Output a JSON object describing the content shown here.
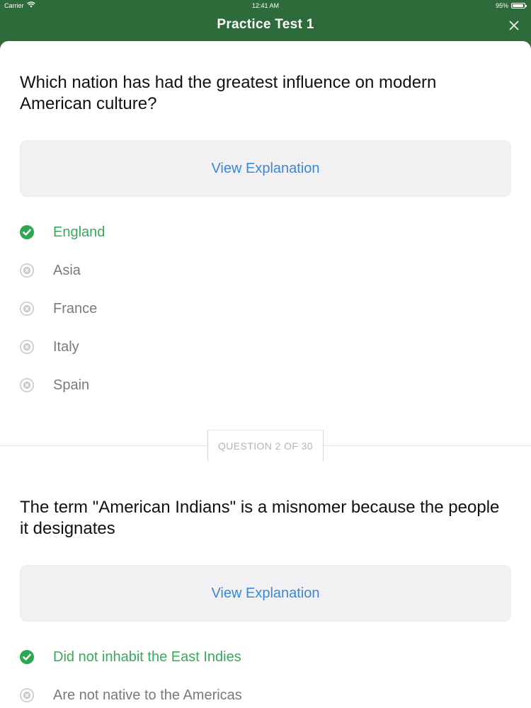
{
  "status_bar": {
    "carrier": "Carrier",
    "time": "12:41 AM",
    "battery": "95%",
    "battery_level": 0.95
  },
  "nav": {
    "title": "Practice Test 1",
    "close_icon": "close-icon"
  },
  "colors": {
    "header_bg": "#2e6b3a",
    "correct": "#3aa85a",
    "link": "#3a87d4",
    "muted": "#7a7a7a"
  },
  "questions": [
    {
      "text": "Which nation has had the greatest influence on modern American culture?",
      "explanation_label": "View Explanation",
      "answers": [
        {
          "label": "England",
          "correct": true,
          "icon": "check-circle-icon"
        },
        {
          "label": "Asia",
          "correct": false,
          "icon": "x-circle-icon"
        },
        {
          "label": "France",
          "correct": false,
          "icon": "x-circle-icon"
        },
        {
          "label": "Italy",
          "correct": false,
          "icon": "x-circle-icon"
        },
        {
          "label": "Spain",
          "correct": false,
          "icon": "x-circle-icon"
        }
      ]
    },
    {
      "counter": "QUESTION 2 OF 30",
      "text": "The term \"American Indians\" is a misnomer because the people it designates",
      "explanation_label": "View Explanation",
      "answers": [
        {
          "label": "Did not inhabit the East Indies",
          "correct": true,
          "icon": "check-circle-icon"
        },
        {
          "label": "Are not native to the Americas",
          "correct": false,
          "icon": "x-circle-icon"
        }
      ]
    }
  ]
}
